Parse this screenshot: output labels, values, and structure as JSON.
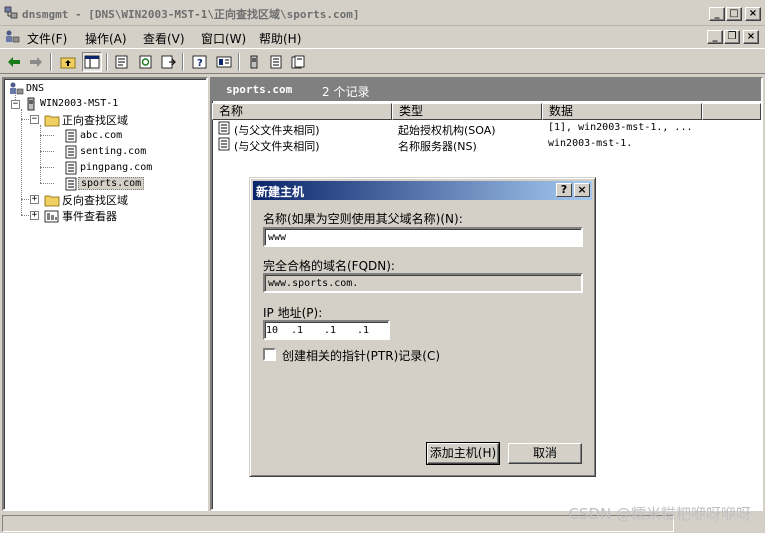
{
  "window": {
    "title": "dnsmgmt - [DNS\\WIN2003-MST-1\\正向查找区域\\sports.com]",
    "caption_buttons": [
      "_",
      "□",
      "×"
    ],
    "mdi_buttons": [
      "_",
      "❐",
      "×"
    ]
  },
  "menu": {
    "items": [
      "文件(F)",
      "操作(A)",
      "查看(V)",
      "窗口(W)",
      "帮助(H)"
    ]
  },
  "tree": {
    "root": "DNS",
    "server": "WIN2003-MST-1",
    "forward_zone": "正向查找区域",
    "zones": [
      "abc.com",
      "senting.com",
      "pingpang.com",
      "sports.com"
    ],
    "reverse_zone": "反向查找区域",
    "event_viewer": "事件查看器"
  },
  "right": {
    "zone_title": "sports.com",
    "record_count": "2 个记录",
    "columns": [
      "名称",
      "类型",
      "数据"
    ],
    "rows": [
      {
        "name": "(与父文件夹相同)",
        "type": "起始授权机构(SOA)",
        "data": "[1], win2003-mst-1., ..."
      },
      {
        "name": "(与父文件夹相同)",
        "type": "名称服务器(NS)",
        "data": "win2003-mst-1."
      }
    ]
  },
  "dialog": {
    "title": "新建主机",
    "help_btn": "?",
    "close_btn": "×",
    "name_label": "名称(如果为空则使用其父域名称)(N):",
    "name_value": "www",
    "fqdn_label": "完全合格的域名(FQDN):",
    "fqdn_value": "www.sports.com.",
    "ip_label": "IP 地址(P):",
    "ip_octets": [
      "10",
      ".1",
      ".1",
      ".1"
    ],
    "ptr_label": "创建相关的指针(PTR)记录(C)",
    "ptr_checked": false,
    "add_button": "添加主机(H)",
    "cancel_button": "取消"
  },
  "watermark": "CSDN @糯米糍粑咿呀咿呀",
  "colors": {
    "face": "#d4d0c8",
    "title_active_start": "#0a246a",
    "title_active_end": "#a6caf0",
    "header_gray": "#808080"
  }
}
